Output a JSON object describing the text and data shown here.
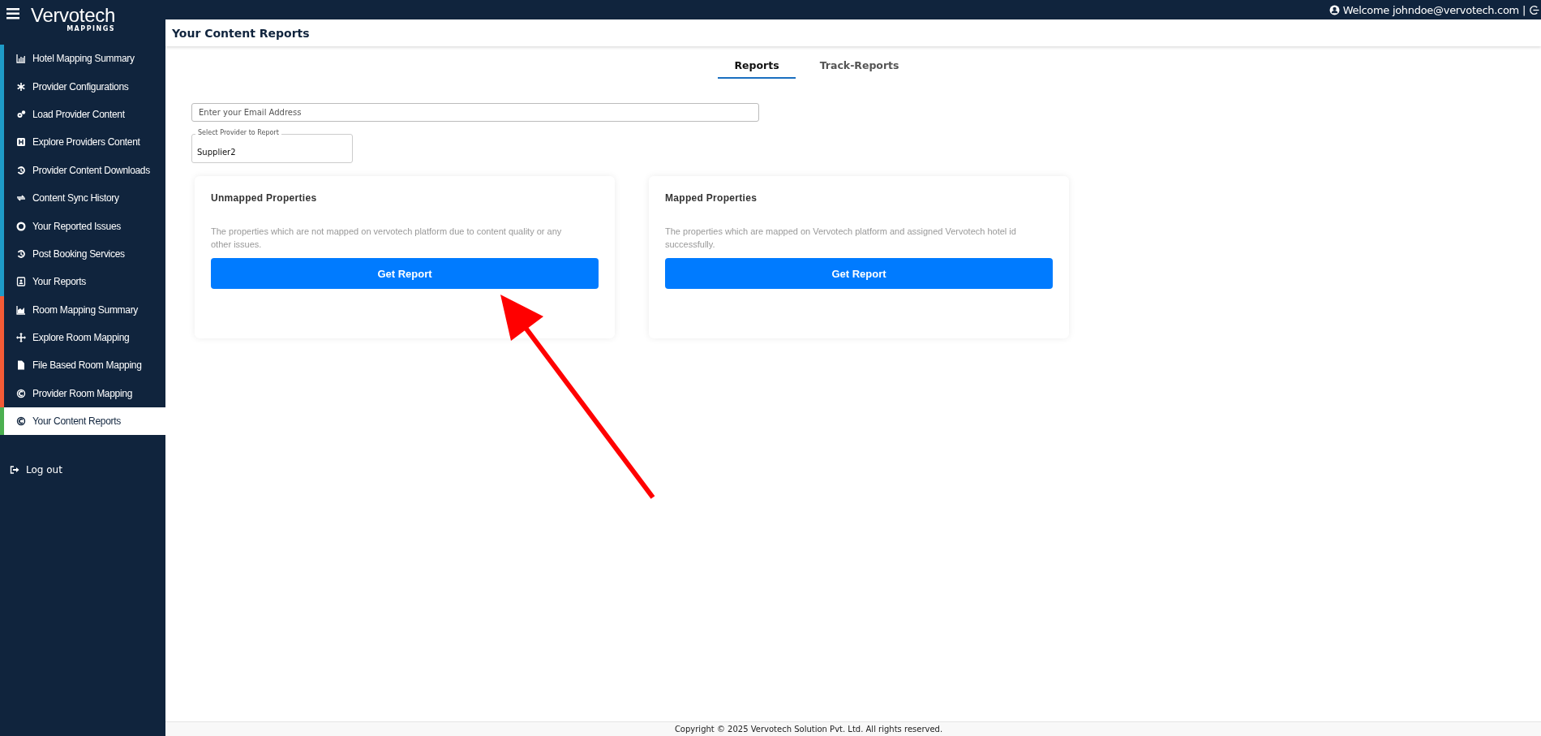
{
  "brand": {
    "name": "Vervotech",
    "subtitle": "MAPPINGS"
  },
  "top_bar": {
    "welcome": "Welcome johndoe@vervotech.com",
    "separator": "|"
  },
  "sidebar": {
    "items": [
      {
        "label": "Hotel Mapping Summary",
        "color": "#1e9bc8",
        "selected": false
      },
      {
        "label": "Provider Configurations",
        "color": "#1e9bc8",
        "selected": false
      },
      {
        "label": "Load Provider Content",
        "color": "#1e9bc8",
        "selected": false
      },
      {
        "label": "Explore Providers Content",
        "color": "#1e9bc8",
        "selected": false
      },
      {
        "label": "Provider Content Downloads",
        "color": "#1e9bc8",
        "selected": false
      },
      {
        "label": "Content Sync History",
        "color": "#1e9bc8",
        "selected": false
      },
      {
        "label": "Your Reported Issues",
        "color": "#1e9bc8",
        "selected": false
      },
      {
        "label": "Post Booking Services",
        "color": "#1e9bc8",
        "selected": false
      },
      {
        "label": "Your Reports",
        "color": "#1e9bc8",
        "selected": false
      },
      {
        "label": "Room Mapping Summary",
        "color": "#f45b36",
        "selected": false
      },
      {
        "label": "Explore Room Mapping",
        "color": "#f45b36",
        "selected": false
      },
      {
        "label": "File Based Room Mapping",
        "color": "#f45b36",
        "selected": false
      },
      {
        "label": "Provider Room Mapping",
        "color": "#f45b36",
        "selected": false
      },
      {
        "label": "Your Content Reports",
        "color": "#4caf50",
        "selected": true
      }
    ],
    "logout": "Log out"
  },
  "page_title": "Your Content Reports",
  "tabs": [
    {
      "label": "Reports",
      "selected": true
    },
    {
      "label": "Track-Reports",
      "selected": false
    }
  ],
  "email_field": {
    "placeholder": "Enter your Email Address"
  },
  "provider_select": {
    "label": "Select Provider to Report",
    "value": "Supplier2"
  },
  "cards": [
    {
      "title": "Unmapped Properties",
      "description": "The properties which are not mapped on vervotech platform due to content quality or any other issues.",
      "button": "Get Report"
    },
    {
      "title": "Mapped Properties",
      "description": "The properties which are mapped on Vervotech platform and assigned Vervotech hotel id successfully.",
      "button": "Get Report"
    }
  ],
  "footer": "Copyright © 2025 Vervotech Solution Pvt. Ltd. All rights reserved."
}
